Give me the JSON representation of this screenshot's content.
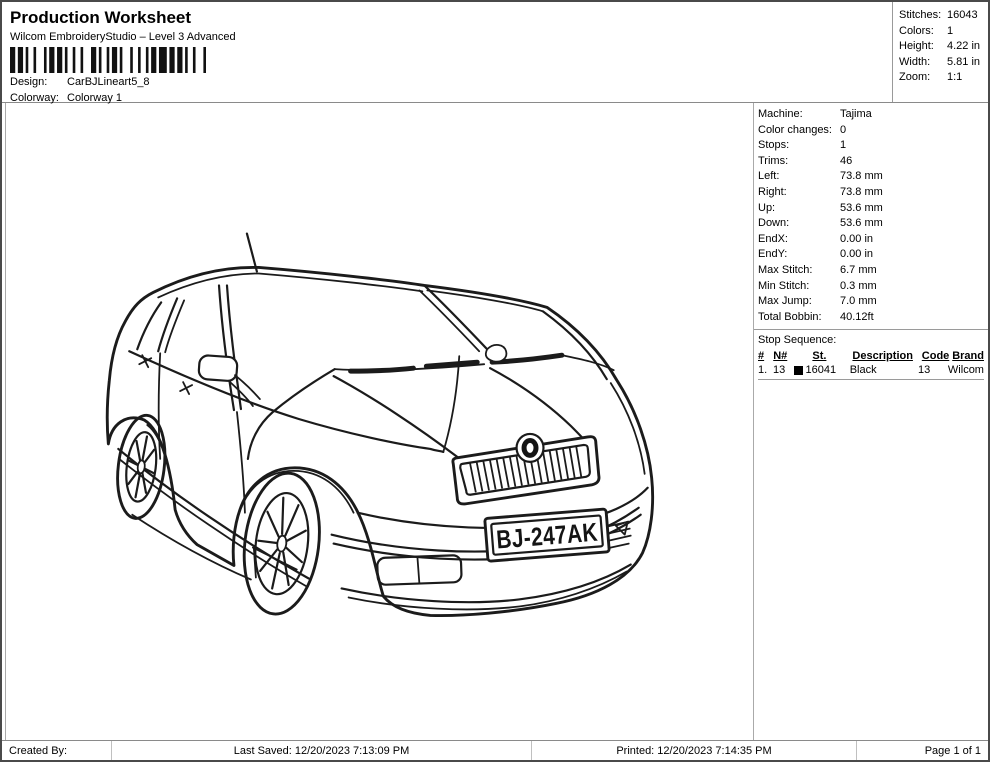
{
  "header": {
    "title": "Production Worksheet",
    "subtitle": "Wilcom EmbroideryStudio – Level 3 Advanced",
    "design_label": "Design:",
    "design_value": "CarBJLineart5_8",
    "colorway_label": "Colorway:",
    "colorway_value": "Colorway 1"
  },
  "summary": {
    "rows": [
      {
        "label": "Stitches:",
        "value": "16043"
      },
      {
        "label": "Colors:",
        "value": "1"
      },
      {
        "label": "Height:",
        "value": "4.22 in"
      },
      {
        "label": "Width:",
        "value": "5.81 in"
      },
      {
        "label": "Zoom:",
        "value": "1:1"
      }
    ]
  },
  "details": {
    "rows": [
      {
        "label": "Machine:",
        "value": "Tajima"
      },
      {
        "label": "Color changes:",
        "value": "0"
      },
      {
        "label": "Stops:",
        "value": "1"
      },
      {
        "label": "Trims:",
        "value": "46"
      },
      {
        "label": "Left:",
        "value": "73.8 mm"
      },
      {
        "label": "Right:",
        "value": "73.8 mm"
      },
      {
        "label": "Up:",
        "value": "53.6 mm"
      },
      {
        "label": "Down:",
        "value": "53.6 mm"
      },
      {
        "label": "EndX:",
        "value": "0.00 in"
      },
      {
        "label": "EndY:",
        "value": "0.00 in"
      },
      {
        "label": "Max Stitch:",
        "value": "6.7 mm"
      },
      {
        "label": "Min Stitch:",
        "value": "0.3 mm"
      },
      {
        "label": "Max Jump:",
        "value": "7.0 mm"
      },
      {
        "label": "Total Bobbin:",
        "value": "40.12ft"
      }
    ]
  },
  "stop_sequence": {
    "label": "Stop Sequence:",
    "headers": {
      "num": "#",
      "n": "N#",
      "st": "St.",
      "description": "Description",
      "code": "Code",
      "brand": "Brand"
    },
    "rows": [
      {
        "num": "1.",
        "n": "13",
        "swatch_color": "#000000",
        "st": "16041",
        "description": "Black",
        "code": "13",
        "brand": "Wilcom"
      }
    ]
  },
  "design": {
    "license_plate": "BJ-247AK",
    "stroke_color": "#1b1b1b"
  },
  "footer": {
    "created_by": "Created By:",
    "last_saved": "Last Saved: 12/20/2023 7:13:09 PM",
    "printed": "Printed: 12/20/2023 7:14:35 PM",
    "page": "Page 1 of 1"
  }
}
